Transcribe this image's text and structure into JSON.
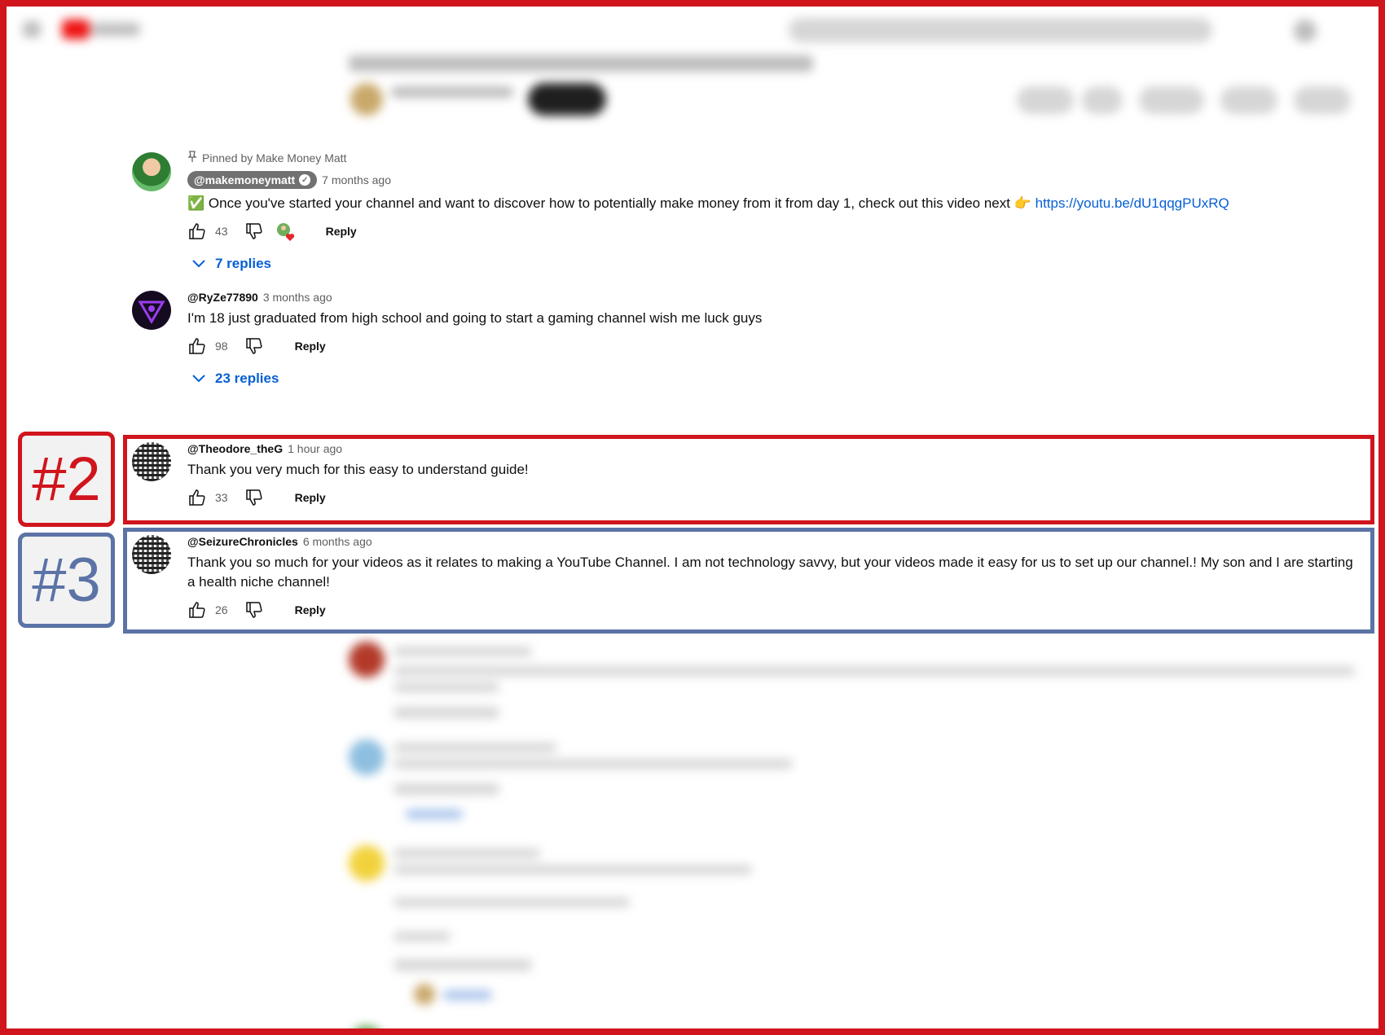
{
  "comments": [
    {
      "pinned_text": "Pinned by Make Money Matt",
      "handle": "@makemoneymatt",
      "time": "7 months ago",
      "text": "✅ Once you've started your channel and want to discover how to potentially make money from it from day 1, check out this video next 👉",
      "link": "https://youtu.be/dU1qqgPUxRQ",
      "likes": "43",
      "reply_label": "Reply",
      "replies": "7 replies"
    },
    {
      "handle": "@RyZe77890",
      "time": "3 months ago",
      "text": "I'm 18 just graduated from high school and going to start a gaming channel wish me luck guys",
      "likes": "98",
      "reply_label": "Reply",
      "replies": "23 replies"
    },
    {
      "handle": "@Theodore_theG",
      "time": "1 hour ago",
      "text": "Thank you very much for this easy to understand guide!",
      "likes": "33",
      "reply_label": "Reply"
    },
    {
      "handle": "@SeizureChronicles",
      "time": "6 months ago",
      "text": "Thank you so much for your videos as it relates to making a YouTube Channel. I am not technology savvy, but your videos made it easy for us to set up our channel.! My son and I are starting a health niche channel!",
      "likes": "26",
      "reply_label": "Reply"
    }
  ],
  "annotations": {
    "label_2": "#2",
    "label_3": "#3",
    "red": "#d0151c",
    "blue": "#5b73a6"
  },
  "icons": [
    "pin-icon",
    "verified-icon",
    "thumbs-up-icon",
    "thumbs-down-icon",
    "creator-heart-icon",
    "chevron-down-icon"
  ]
}
